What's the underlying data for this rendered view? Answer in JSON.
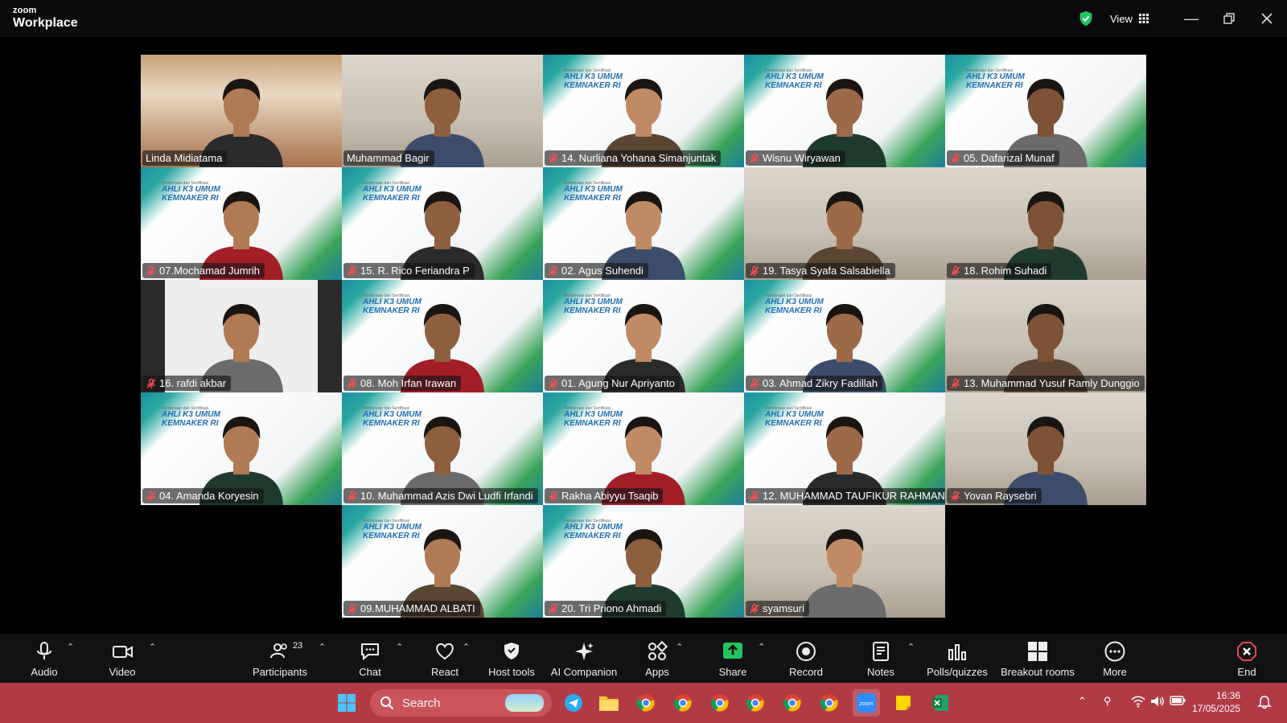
{
  "app": {
    "brand_top": "zoom",
    "brand_bottom": "Workplace"
  },
  "titlebar": {
    "view_label": "View"
  },
  "participants": [
    {
      "name": "Linda Midiatama",
      "muted": false,
      "bg": "office"
    },
    {
      "name": "Muhammad Bagir",
      "muted": false,
      "bg": "room"
    },
    {
      "name": "14. Nurliana Yohana Simanjuntak",
      "muted": true,
      "bg": "banner"
    },
    {
      "name": "Wisnu Wiryawan",
      "muted": true,
      "bg": "banner"
    },
    {
      "name": "05. Dafarizal Munaf",
      "muted": true,
      "bg": "banner"
    },
    {
      "name": "07.Mochamad Jumrih",
      "muted": true,
      "bg": "banner"
    },
    {
      "name": "15. R. Rico Feriandra P",
      "muted": true,
      "bg": "banner"
    },
    {
      "name": "02. Agus Suhendi",
      "muted": true,
      "bg": "banner"
    },
    {
      "name": "19. Tasya Syafa Salsabiella",
      "muted": true,
      "bg": "room"
    },
    {
      "name": "18. Rohim Suhadi",
      "muted": true,
      "bg": "room"
    },
    {
      "name": "16. rafdi akbar",
      "muted": true,
      "bg": "plain"
    },
    {
      "name": "08. Moh Irfan Irawan",
      "muted": true,
      "bg": "banner"
    },
    {
      "name": "01. Agung Nur Apriyanto",
      "muted": true,
      "bg": "banner"
    },
    {
      "name": "03. Ahmad Zikry Fadillah",
      "muted": true,
      "bg": "banner"
    },
    {
      "name": "13. Muhammad Yusuf Ramly Dunggio",
      "muted": true,
      "bg": "room"
    },
    {
      "name": "04. Amanda Koryesin",
      "muted": true,
      "bg": "banner"
    },
    {
      "name": "10. Muhammad Azis Dwi Ludfi Irfandi",
      "muted": true,
      "bg": "banner"
    },
    {
      "name": "Rakha Abiyyu Tsaqib",
      "muted": true,
      "bg": "banner"
    },
    {
      "name": "12. MUHAMMAD TAUFIKUR RAHMAN",
      "muted": true,
      "bg": "banner"
    },
    {
      "name": "Yovan Raysebri",
      "muted": true,
      "bg": "room"
    },
    {
      "name": "09.MUHAMMAD ALBATI",
      "muted": true,
      "bg": "banner"
    },
    {
      "name": "20. Tri Priono Ahmadi",
      "muted": true,
      "bg": "banner"
    },
    {
      "name": "syamsuri",
      "muted": true,
      "bg": "room"
    }
  ],
  "banner": {
    "small": "Pembinaan dan Sertifikasi",
    "line1": "AHLI K3 UMUM",
    "line2": "KEMNAKER RI"
  },
  "toolbar": {
    "audio": "Audio",
    "video": "Video",
    "participants": "Participants",
    "participants_count": "23",
    "chat": "Chat",
    "react": "React",
    "host_tools": "Host tools",
    "ai_companion": "AI Companion",
    "apps": "Apps",
    "share": "Share",
    "record": "Record",
    "notes": "Notes",
    "polls": "Polls/quizzes",
    "breakout": "Breakout rooms",
    "more": "More",
    "end": "End"
  },
  "taskbar": {
    "search_placeholder": "Search",
    "time": "16:36",
    "date": "17/05/2025"
  },
  "colors": {
    "active_border": "#2ed573",
    "share_green": "#22c55e",
    "end_red": "#e5484d",
    "taskbar": "#b13b44"
  }
}
